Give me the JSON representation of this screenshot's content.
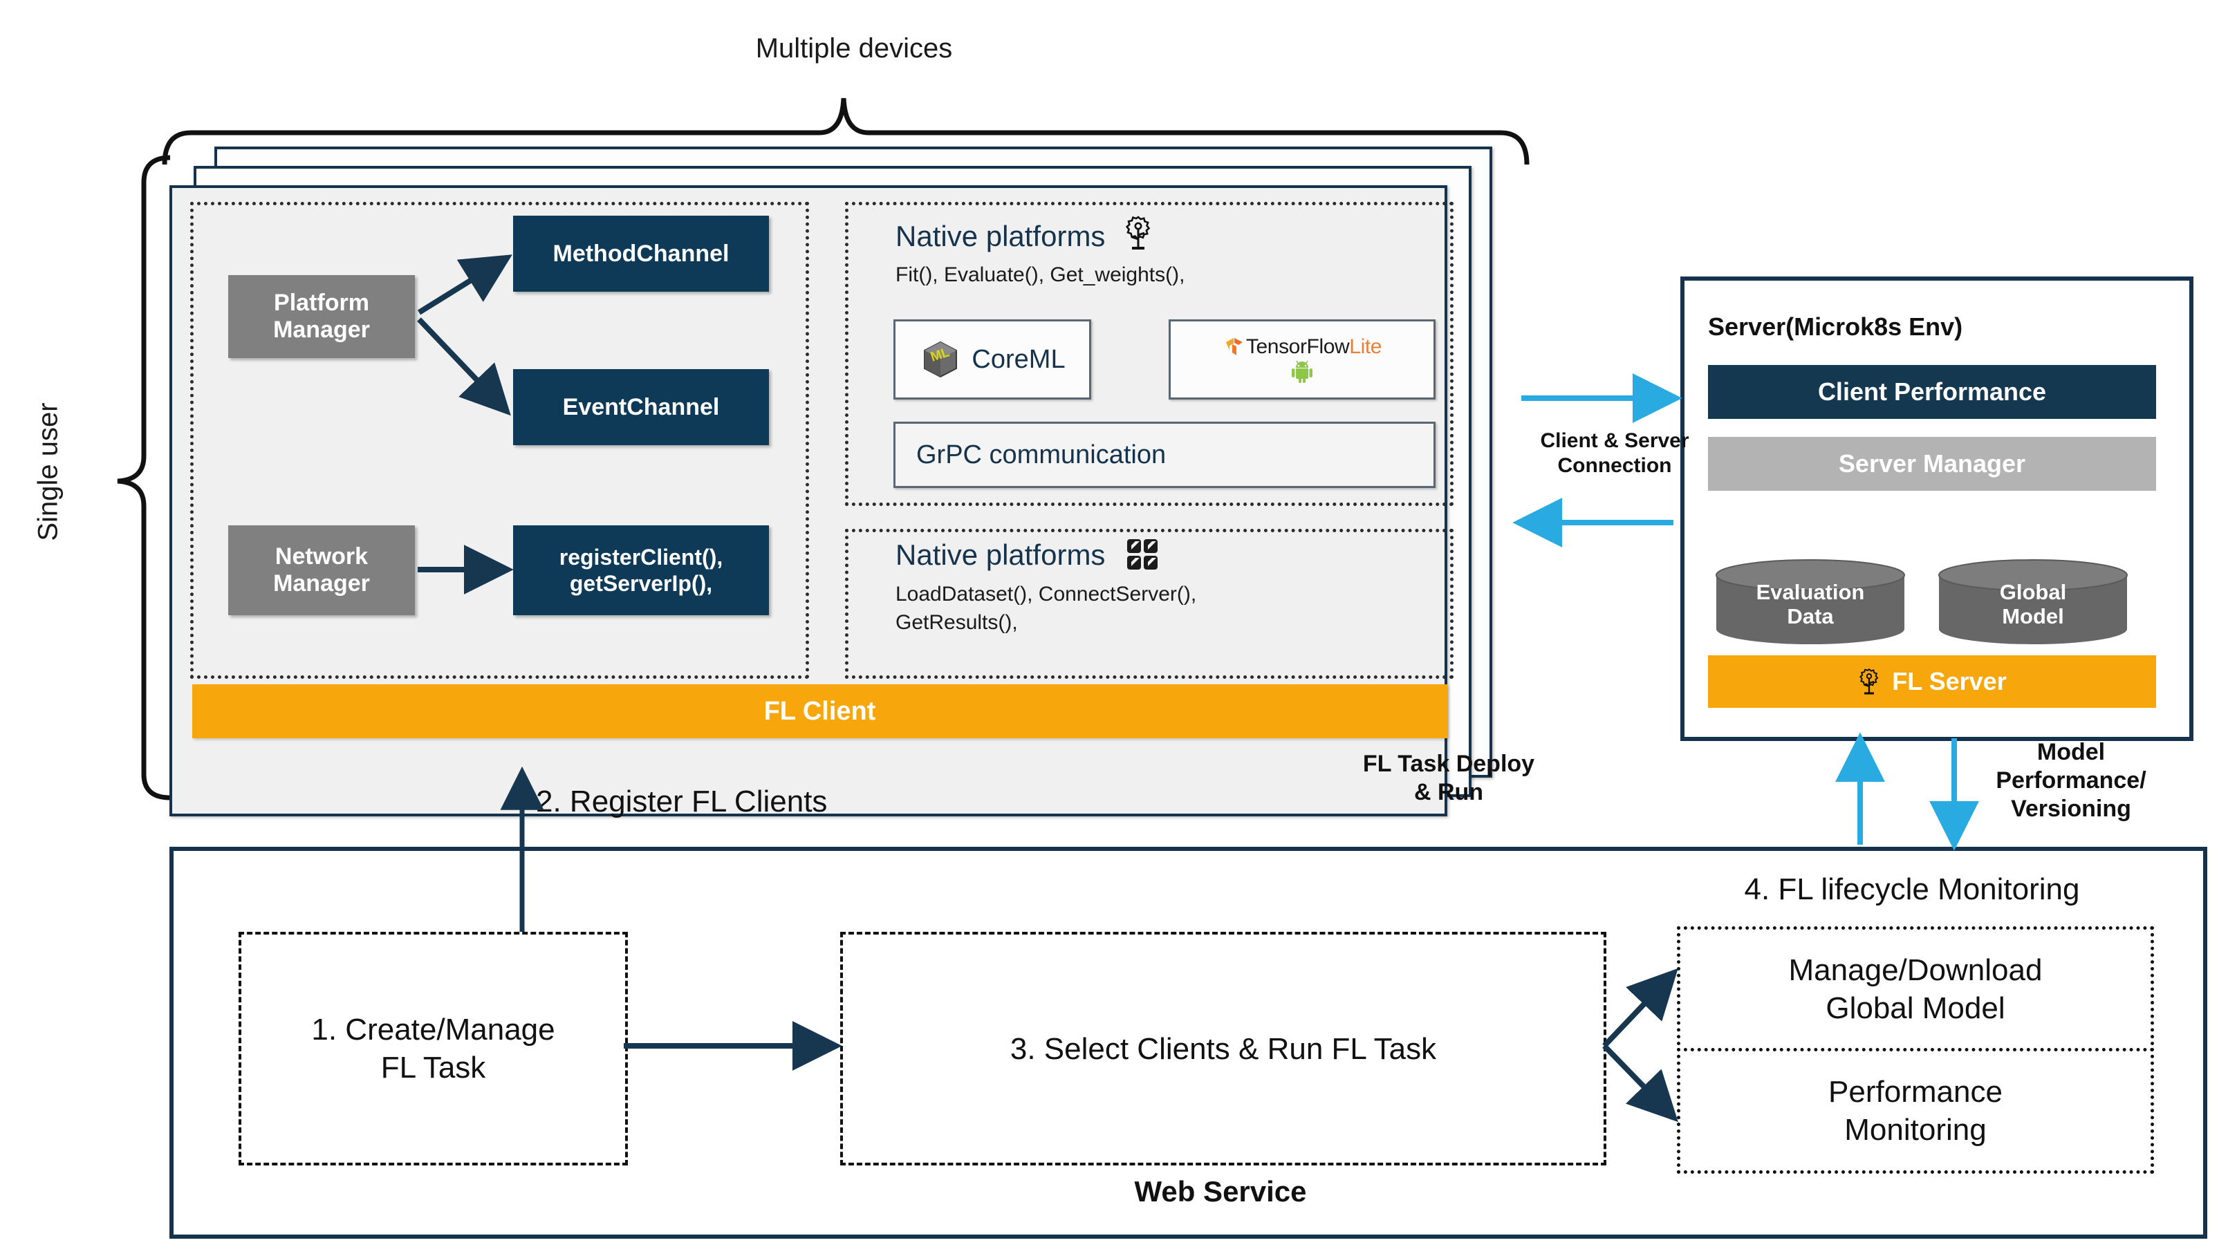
{
  "labels": {
    "multiple_devices": "Multiple devices",
    "single_user": "Single user",
    "client_server_connection": "Client & Server\nConnection",
    "fl_task_deploy": "FL Task Deploy\n& Run",
    "model_perf_versioning": "Model\nPerformance/\nVersioning",
    "register_fl_clients": "2. Register FL Clients",
    "web_service": "Web Service"
  },
  "client": {
    "platform_manager": "Platform\nManager",
    "network_manager": "Network\nManager",
    "method_channel": "MethodChannel",
    "event_channel": "EventChannel",
    "register_client": "registerClient(),\ngetServerIp(),",
    "fl_client_bar": "FL Client",
    "native_platforms_1": {
      "title": "Native platforms",
      "icon": "flower-icon",
      "methods": "Fit(), Evaluate(), Get_weights(),",
      "tiles": [
        {
          "name": "CoreML",
          "icon": "coreml-icon"
        },
        {
          "name": "TensorFlow Lite",
          "name_part1": "TensorFlow",
          "name_part2": "Lite",
          "icon": "android-icon"
        }
      ],
      "grpc": "GrPC communication"
    },
    "native_platforms_2": {
      "title": "Native platforms",
      "icon": "grid-four-squares-icon",
      "methods": "LoadDataset(), ConnectServer(),\nGetResults(),"
    }
  },
  "server": {
    "title": "Server(Microk8s Env)",
    "client_performance": "Client Performance",
    "server_manager": "Server Manager",
    "evaluation_data": "Evaluation\nData",
    "global_model": "Global\nModel",
    "fl_server": "FL Server",
    "fl_server_icon": "flower-icon"
  },
  "web_service": {
    "step1": "1. Create/Manage\nFL Task",
    "step3": "3. Select Clients & Run FL Task",
    "step4_title": "4. FL lifecycle Monitoring",
    "step4_items": [
      "Manage/Download\nGlobal Model",
      "Performance\nMonitoring"
    ]
  },
  "colors": {
    "navy": "#0e3a57",
    "navy_border": "#15334d",
    "gray": "#808080",
    "light_gray": "#b3b3b3",
    "orange": "#F7A70C",
    "cyan_arrow": "#29ABE2",
    "panel_bg": "#f0f0f0"
  }
}
